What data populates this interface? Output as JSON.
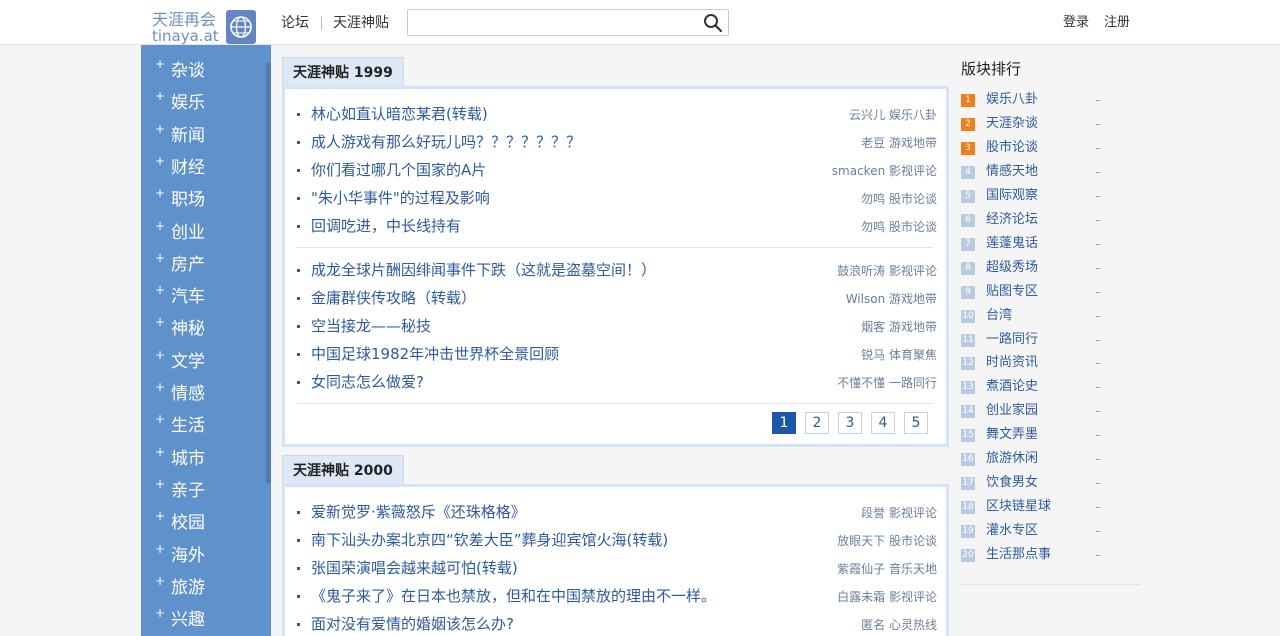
{
  "header": {
    "logo_cn": "天涯再会",
    "logo_en": "tinaya.at",
    "nav": [
      "论坛",
      "天涯神贴"
    ],
    "search": {
      "value": "",
      "placeholder": ""
    },
    "login": "登录",
    "register": "注册"
  },
  "sidebar": {
    "items": [
      "杂谈",
      "娱乐",
      "新闻",
      "财经",
      "职场",
      "创业",
      "房产",
      "汽车",
      "神秘",
      "文学",
      "情感",
      "生活",
      "城市",
      "亲子",
      "校园",
      "海外",
      "旅游",
      "兴趣"
    ]
  },
  "panels": [
    {
      "tab": "天涯神贴 1999",
      "groups": [
        [
          {
            "title": "林心如直认暗恋某君(转载)",
            "meta": "云兴儿 娱乐八卦"
          },
          {
            "title": "成人游戏有那么好玩儿吗？？？？？？？",
            "meta": "老豆 游戏地带"
          },
          {
            "title": "你们看过哪几个国家的A片",
            "meta": "smacken 影视评论"
          },
          {
            "title": "\"朱小华事件\"的过程及影响",
            "meta": "勿鸣 股市论谈"
          },
          {
            "title": "回调吃进，中长线持有",
            "meta": "勿鸣 股市论谈"
          }
        ],
        [
          {
            "title": "成龙全球片酬因绯闻事件下跌（这就是盗墓空间！）",
            "meta": "鼓浪听涛 影视评论"
          },
          {
            "title": "金庸群侠传攻略（转载）",
            "meta": "Wilson 游戏地带"
          },
          {
            "title": "空当接龙——秘技",
            "meta": "烟客 游戏地带"
          },
          {
            "title": "中国足球1982年冲击世界杯全景回顾",
            "meta": "锐马 体育聚焦"
          },
          {
            "title": "女同志怎么做爱?",
            "meta": "不懂不懂 一路同行"
          }
        ]
      ],
      "pages": [
        "1",
        "2",
        "3",
        "4",
        "5"
      ],
      "current_page": "1"
    },
    {
      "tab": "天涯神贴 2000",
      "groups": [
        [
          {
            "title": "爱新觉罗·紫薇怒斥《还珠格格》",
            "meta": "段誉 影视评论"
          },
          {
            "title": "南下汕头办案北京四“钦差大臣”葬身迎宾馆火海(转载)",
            "meta": "放眼天下 股市论谈"
          },
          {
            "title": "张国荣演唱会越来越可怕(转载)",
            "meta": "紫霞仙子 音乐天地"
          },
          {
            "title": "《鬼子来了》在日本也禁放，但和在中国禁放的理由不一样。",
            "meta": "白露未霜 影视评论"
          },
          {
            "title": "面对没有爱情的婚姻该怎么办?",
            "meta": "匿名 心灵热线"
          }
        ]
      ]
    }
  ],
  "rankings": {
    "title": "版块排行",
    "items": [
      {
        "num": "1",
        "label": "娱乐八卦",
        "trend": "–"
      },
      {
        "num": "2",
        "label": "天涯杂谈",
        "trend": "–"
      },
      {
        "num": "3",
        "label": "股市论谈",
        "trend": "–"
      },
      {
        "num": "4",
        "label": "情感天地",
        "trend": "–"
      },
      {
        "num": "5",
        "label": "国际观察",
        "trend": "–"
      },
      {
        "num": "6",
        "label": "经济论坛",
        "trend": "–"
      },
      {
        "num": "7",
        "label": "莲蓬鬼话",
        "trend": "–"
      },
      {
        "num": "8",
        "label": "超级秀场",
        "trend": "–"
      },
      {
        "num": "9",
        "label": "贴图专区",
        "trend": "–"
      },
      {
        "num": "10",
        "label": "台湾",
        "trend": "–"
      },
      {
        "num": "11",
        "label": "一路同行",
        "trend": "–"
      },
      {
        "num": "12",
        "label": "时尚资讯",
        "trend": "–"
      },
      {
        "num": "13",
        "label": "煮酒论史",
        "trend": "–"
      },
      {
        "num": "14",
        "label": "创业家园",
        "trend": "–"
      },
      {
        "num": "15",
        "label": "舞文弄墨",
        "trend": "–"
      },
      {
        "num": "16",
        "label": "旅游休闲",
        "trend": "–"
      },
      {
        "num": "17",
        "label": "饮食男女",
        "trend": "–"
      },
      {
        "num": "18",
        "label": "区块链星球",
        "trend": "–"
      },
      {
        "num": "19",
        "label": "灌水专区",
        "trend": "–"
      },
      {
        "num": "20",
        "label": "生活那点事",
        "trend": "–"
      }
    ]
  },
  "colors": {
    "sidebar": "#5f91ca",
    "link": "#2e5b9e",
    "hot_rank": "#f07f1a",
    "active_page": "#1d55a8"
  }
}
